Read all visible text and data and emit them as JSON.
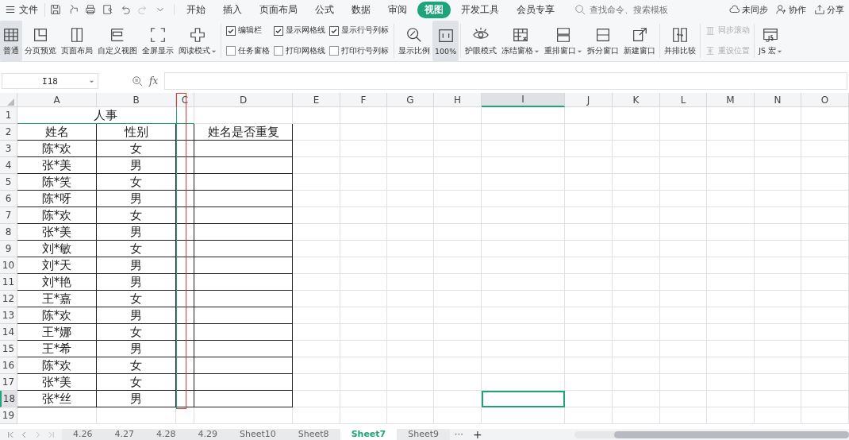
{
  "menu_bar": {
    "file": "文件",
    "tabs": [
      {
        "label": "开始",
        "selected": false
      },
      {
        "label": "插入",
        "selected": false
      },
      {
        "label": "页面布局",
        "selected": false
      },
      {
        "label": "公式",
        "selected": false
      },
      {
        "label": "数据",
        "selected": false
      },
      {
        "label": "审阅",
        "selected": false
      },
      {
        "label": "视图",
        "selected": true
      },
      {
        "label": "开发工具",
        "selected": false
      },
      {
        "label": "会员专享",
        "selected": false
      }
    ],
    "search": {
      "placeholder": "查找命令、搜索模板"
    },
    "actions": [
      "未同步",
      "协作",
      "分享"
    ]
  },
  "ribbon": [
    {
      "kind": "big",
      "label": "普通",
      "selected": true,
      "dropdown": false
    },
    {
      "kind": "big",
      "label": "分页预览",
      "selected": false,
      "dropdown": false
    },
    {
      "kind": "big",
      "label": "页面布局",
      "selected": false,
      "dropdown": false
    },
    {
      "kind": "big",
      "label": "自定义视图",
      "selected": false,
      "dropdown": false
    },
    {
      "kind": "big",
      "label": "全屏显示",
      "selected": false,
      "dropdown": false
    },
    {
      "kind": "big",
      "label": "阅读模式",
      "selected": false,
      "dropdown": true
    },
    {
      "kind": "checks",
      "items": [
        {
          "label": "编辑栏",
          "checked": true
        },
        {
          "label": "任务窗格",
          "checked": false
        },
        {
          "label": "显示网格线",
          "checked": true
        },
        {
          "label": "打印网格线",
          "checked": false
        },
        {
          "label": "显示行号列标",
          "checked": true
        },
        {
          "label": "打印行号列标",
          "checked": false
        }
      ]
    },
    {
      "kind": "big",
      "label": "显示比例",
      "selected": false,
      "dropdown": false
    },
    {
      "kind": "big",
      "label": "100%",
      "selected": true,
      "dropdown": false
    },
    {
      "kind": "big",
      "label": "护眼模式",
      "selected": false,
      "dropdown": false
    },
    {
      "kind": "big",
      "label": "冻结窗格",
      "selected": false,
      "dropdown": true
    },
    {
      "kind": "big",
      "label": "重排窗口",
      "selected": false,
      "dropdown": true
    },
    {
      "kind": "big",
      "label": "拆分窗口",
      "selected": false,
      "dropdown": false
    },
    {
      "kind": "big",
      "label": "新建窗口",
      "selected": false,
      "dropdown": false
    },
    {
      "kind": "big",
      "label": "并排比较",
      "selected": false,
      "dropdown": false
    },
    {
      "kind": "small",
      "items": [
        {
          "label": "同步滚动",
          "disabled": true
        },
        {
          "label": "重设位置",
          "disabled": true
        }
      ]
    },
    {
      "kind": "big",
      "label": "JS 宏",
      "selected": false,
      "dropdown": true
    }
  ],
  "formula_bar": {
    "cell_ref": "I18",
    "fx": "fx"
  },
  "sheet": {
    "columns": [
      {
        "letter": "A",
        "selected": false
      },
      {
        "letter": "B",
        "selected": false
      },
      {
        "letter": "C",
        "selected": false
      },
      {
        "letter": "D",
        "selected": false
      },
      {
        "letter": "E",
        "selected": false
      },
      {
        "letter": "F",
        "selected": false
      },
      {
        "letter": "G",
        "selected": false
      },
      {
        "letter": "H",
        "selected": false
      },
      {
        "letter": "I",
        "selected": true
      },
      {
        "letter": "J",
        "selected": false
      },
      {
        "letter": "K",
        "selected": false
      },
      {
        "letter": "L",
        "selected": false
      },
      {
        "letter": "M",
        "selected": false
      },
      {
        "letter": "N",
        "selected": false
      },
      {
        "letter": "O",
        "selected": false
      }
    ],
    "rows": [
      {
        "number": "1",
        "selected": false
      },
      {
        "number": "2",
        "selected": false
      },
      {
        "number": "3",
        "selected": false
      },
      {
        "number": "4",
        "selected": false
      },
      {
        "number": "5",
        "selected": false
      },
      {
        "number": "6",
        "selected": false
      },
      {
        "number": "7",
        "selected": false
      },
      {
        "number": "8",
        "selected": false
      },
      {
        "number": "9",
        "selected": false
      },
      {
        "number": "10",
        "selected": false
      },
      {
        "number": "11",
        "selected": false
      },
      {
        "number": "12",
        "selected": false
      },
      {
        "number": "13",
        "selected": false
      },
      {
        "number": "14",
        "selected": false
      },
      {
        "number": "15",
        "selected": false
      },
      {
        "number": "16",
        "selected": false
      },
      {
        "number": "17",
        "selected": false
      },
      {
        "number": "18",
        "selected": true
      },
      {
        "number": "19",
        "selected": false
      }
    ],
    "title": "人事",
    "headers": {
      "name": "姓名",
      "gender": "性别",
      "duplicate": "姓名是否重复"
    },
    "records": [
      {
        "name": "陈*欢",
        "gender": "女"
      },
      {
        "name": "张*美",
        "gender": "男"
      },
      {
        "name": "陈*笑",
        "gender": "女"
      },
      {
        "name": "陈*呀",
        "gender": "男"
      },
      {
        "name": "陈*欢",
        "gender": "女"
      },
      {
        "name": "张*美",
        "gender": "男"
      },
      {
        "name": "刘*敏",
        "gender": "女"
      },
      {
        "name": "刘*天",
        "gender": "男"
      },
      {
        "name": "刘*艳",
        "gender": "男"
      },
      {
        "name": "王*嘉",
        "gender": "女"
      },
      {
        "name": "陈*欢",
        "gender": "男"
      },
      {
        "name": "王*娜",
        "gender": "女"
      },
      {
        "name": "王*希",
        "gender": "男"
      },
      {
        "name": "陈*欢",
        "gender": "女"
      },
      {
        "name": "张*美",
        "gender": "女"
      },
      {
        "name": "张*丝",
        "gender": "男"
      }
    ]
  },
  "sheet_tabs": [
    {
      "label": "4.26",
      "selected": false
    },
    {
      "label": "4.27",
      "selected": false
    },
    {
      "label": "4.28",
      "selected": false
    },
    {
      "label": "4.29",
      "selected": false
    },
    {
      "label": "Sheet10",
      "selected": false
    },
    {
      "label": "Sheet8",
      "selected": false
    },
    {
      "label": "Sheet7",
      "selected": true
    },
    {
      "label": "Sheet9",
      "selected": false
    }
  ],
  "tab_more": "⋯",
  "tab_add": "+"
}
